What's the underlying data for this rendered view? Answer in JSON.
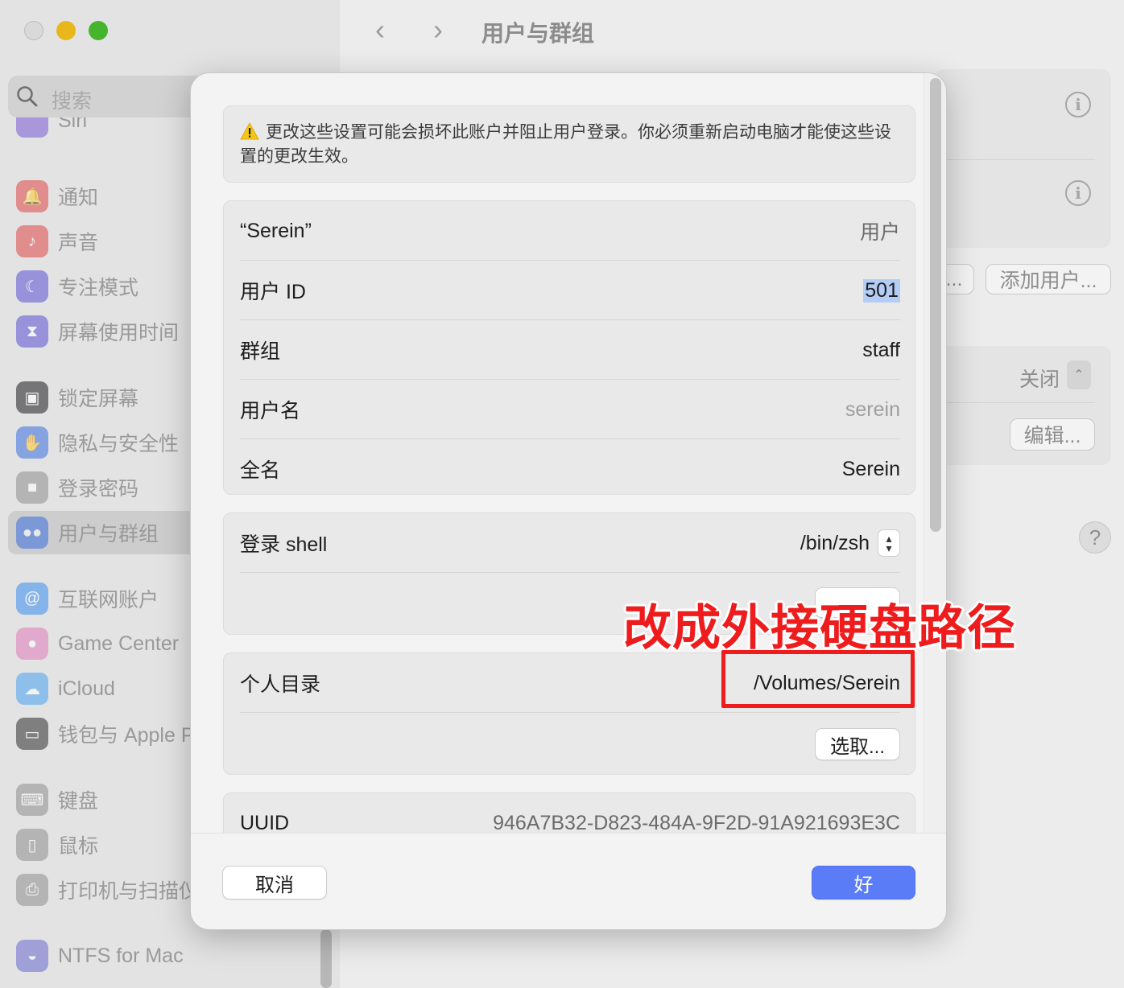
{
  "window": {
    "title": "用户与群组"
  },
  "sidebar": {
    "search_placeholder": "搜索",
    "partial_item": "Siri",
    "items": [
      {
        "label": "通知",
        "icon": "bell-icon",
        "color": "#e0484a"
      },
      {
        "label": "声音",
        "icon": "speaker-icon",
        "color": "#e0484a"
      },
      {
        "label": "专注模式",
        "icon": "moon-icon",
        "color": "#5b50d6"
      },
      {
        "label": "屏幕使用时间",
        "icon": "hourglass-icon",
        "color": "#5b50d6"
      },
      {
        "label": "锁定屏幕",
        "icon": "lock-screen-icon",
        "color": "#1d1d1f"
      },
      {
        "label": "隐私与安全性",
        "icon": "hand-icon",
        "color": "#3a6fe0"
      },
      {
        "label": "登录密码",
        "icon": "lock-icon",
        "color": "#8e8e8e"
      },
      {
        "label": "用户与群组",
        "icon": "users-icon",
        "color": "#3a6fe0"
      },
      {
        "label": "互联网账户",
        "icon": "at-icon",
        "color": "#3a8ef0"
      },
      {
        "label": "Game Center",
        "icon": "game-center-icon",
        "color": "#e07ab8"
      },
      {
        "label": "iCloud",
        "icon": "cloud-icon",
        "color": "#4aa2f0"
      },
      {
        "label": "钱包与 Apple P",
        "icon": "wallet-icon",
        "color": "#2e2e2e"
      },
      {
        "label": "键盘",
        "icon": "keyboard-icon",
        "color": "#8e8e8e"
      },
      {
        "label": "鼠标",
        "icon": "mouse-icon",
        "color": "#8e8e8e"
      },
      {
        "label": "打印机与扫描仪",
        "icon": "printer-icon",
        "color": "#8e8e8e"
      },
      {
        "label": "NTFS for Mac",
        "icon": "ntfs-icon",
        "color": "#6a6ad0"
      }
    ]
  },
  "background": {
    "add_user_label": "添加用户...",
    "partial_button_label": "...",
    "auto_login_value": "关闭",
    "edit_label": "编辑...",
    "help_label": "?"
  },
  "sheet": {
    "warning_text": "更改这些设置可能会损坏此账户并阻止用户登录。你必须重新启动电脑才能使这些设置的更改生效。",
    "account": {
      "name": "“Serein”",
      "type": "用户",
      "uid_label": "用户 ID",
      "uid_value": "501",
      "group_label": "群组",
      "group_value": "staff",
      "username_label": "用户名",
      "username_value": "serein",
      "fullname_label": "全名",
      "fullname_value": "Serein"
    },
    "shell": {
      "label": "登录 shell",
      "value": "/bin/zsh"
    },
    "home": {
      "label": "个人目录",
      "value": "/Volumes/Serein",
      "choose_label": "选取..."
    },
    "uuid": {
      "label": "UUID",
      "value": "946A7B32-D823-484A-9F2D-91A921693E3C"
    },
    "cancel_label": "取消",
    "ok_label": "好"
  },
  "annotation": {
    "text": "改成外接硬盘路径",
    "color": "#ee1c1c"
  }
}
